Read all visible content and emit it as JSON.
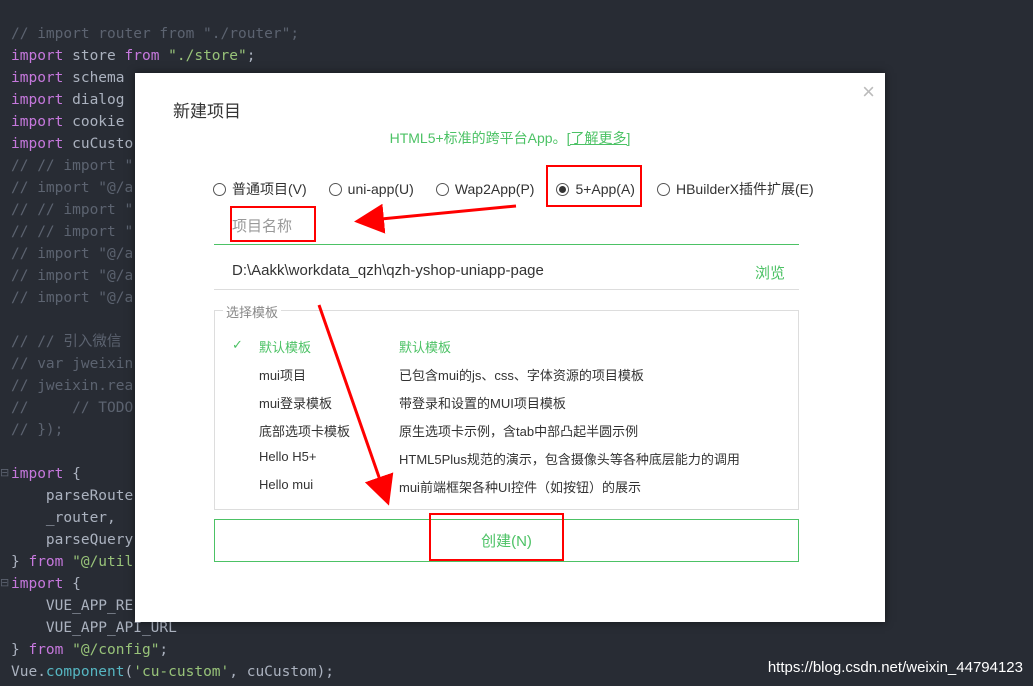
{
  "code_lines": [
    [
      {
        "t": "// import router from \"./router\";",
        "c": "cm"
      }
    ],
    [
      {
        "t": "import",
        "c": "kw"
      },
      {
        "t": " store "
      },
      {
        "t": "from",
        "c": "kw"
      },
      {
        "t": " \"./store\"",
        "c": "str"
      },
      {
        "t": ";"
      }
    ],
    [
      {
        "t": "import",
        "c": "kw"
      },
      {
        "t": " schema"
      }
    ],
    [
      {
        "t": "import",
        "c": "kw"
      },
      {
        "t": " dialog"
      }
    ],
    [
      {
        "t": "import",
        "c": "kw"
      },
      {
        "t": " cookie"
      }
    ],
    [
      {
        "t": "import",
        "c": "kw"
      },
      {
        "t": " cuCusto"
      }
    ],
    [
      {
        "t": "// // import \"",
        "c": "cm"
      }
    ],
    [
      {
        "t": "// import \"@/a",
        "c": "cm"
      }
    ],
    [
      {
        "t": "// // import \"",
        "c": "cm"
      }
    ],
    [
      {
        "t": "// // import \"",
        "c": "cm"
      }
    ],
    [
      {
        "t": "// import \"@/a",
        "c": "cm"
      }
    ],
    [
      {
        "t": "// import \"@/a",
        "c": "cm"
      }
    ],
    [
      {
        "t": "// import \"@/a",
        "c": "cm"
      }
    ],
    [],
    [
      {
        "t": "// // 引入微信",
        "c": "cm"
      }
    ],
    [
      {
        "t": "// var jweixin",
        "c": "cm"
      }
    ],
    [
      {
        "t": "// jweixin.rea",
        "c": "cm"
      }
    ],
    [
      {
        "t": "//     // TODO",
        "c": "cm"
      }
    ],
    [
      {
        "t": "// });",
        "c": "cm"
      }
    ],
    [],
    [
      {
        "t": "import",
        "c": "kw"
      },
      {
        "t": " {"
      }
    ],
    [
      {
        "t": "    parseRoute"
      }
    ],
    [
      {
        "t": "    _router,"
      }
    ],
    [
      {
        "t": "    parseQuery"
      }
    ],
    [
      {
        "t": "} "
      },
      {
        "t": "from",
        "c": "kw"
      },
      {
        "t": " \"@/util",
        "c": "str"
      }
    ],
    [
      {
        "t": "import",
        "c": "kw"
      },
      {
        "t": " {"
      }
    ],
    [
      {
        "t": "    VUE_APP_RE"
      }
    ],
    [
      {
        "t": "    VUE_APP_API_URL"
      }
    ],
    [
      {
        "t": "} "
      },
      {
        "t": "from",
        "c": "kw"
      },
      {
        "t": " \"@/config\"",
        "c": "str"
      },
      {
        "t": ";"
      }
    ],
    [
      {
        "t": "Vue."
      },
      {
        "t": "component",
        "c": "fn"
      },
      {
        "t": "("
      },
      {
        "t": "'cu-custom'",
        "c": "str"
      },
      {
        "t": ", cuCustom);"
      }
    ]
  ],
  "dialog": {
    "title": "新建项目",
    "close": "×",
    "subtitle": "HTML5+标准的跨平台App。",
    "learn_more": "[了解更多]",
    "types": [
      {
        "label": "普通项目(V)",
        "selected": false
      },
      {
        "label": "uni-app(U)",
        "selected": false
      },
      {
        "label": "Wap2App(P)",
        "selected": false
      },
      {
        "label": "5+App(A)",
        "selected": true
      },
      {
        "label": "HBuilderX插件扩展(E)",
        "selected": false
      }
    ],
    "name_placeholder": "项目名称",
    "name_value": "",
    "path": "D:\\Aakk\\workdata_qzh\\qzh-yshop-uniapp-page",
    "browse": "浏览",
    "template_legend": "选择模板",
    "check": "✓",
    "templates": [
      {
        "name": "默认模板",
        "desc": "默认模板",
        "selected": true
      },
      {
        "name": "mui项目",
        "desc": "已包含mui的js、css、字体资源的项目模板"
      },
      {
        "name": "mui登录模板",
        "desc": "带登录和设置的MUI项目模板"
      },
      {
        "name": "底部选项卡模板",
        "desc": "原生选项卡示例，含tab中部凸起半圆示例"
      },
      {
        "name": "Hello H5+",
        "desc": "HTML5Plus规范的演示，包含摄像头等各种底层能力的调用"
      },
      {
        "name": "Hello mui",
        "desc": "mui前端框架各种UI控件（如按钮）的展示"
      }
    ],
    "create": "创建(N)"
  },
  "accent": "#4cc265",
  "annotation_color": "#ff0000",
  "watermark": "https://blog.csdn.net/weixin_44794123"
}
